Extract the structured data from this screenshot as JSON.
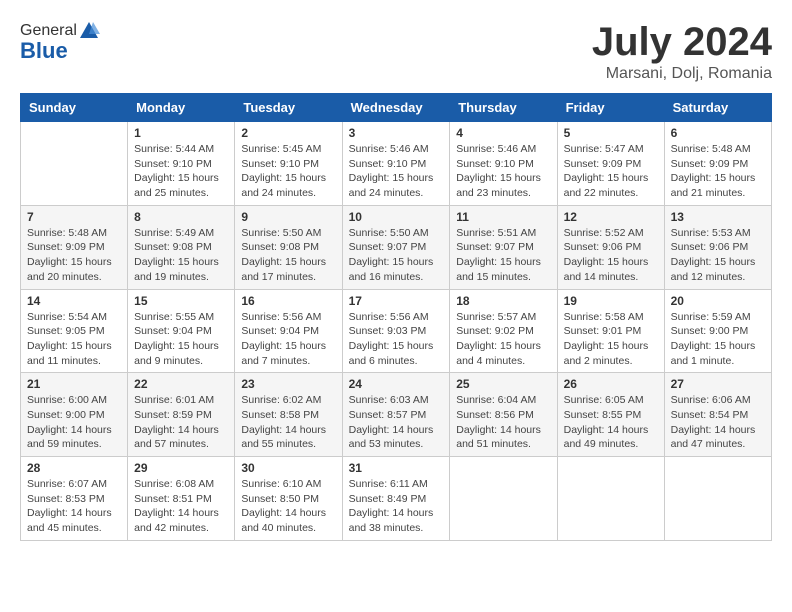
{
  "logo": {
    "general": "General",
    "blue": "Blue"
  },
  "header": {
    "month": "July 2024",
    "location": "Marsani, Dolj, Romania"
  },
  "weekdays": [
    "Sunday",
    "Monday",
    "Tuesday",
    "Wednesday",
    "Thursday",
    "Friday",
    "Saturday"
  ],
  "weeks": [
    [
      {
        "day": "",
        "sunrise": "",
        "sunset": "",
        "daylight": ""
      },
      {
        "day": "1",
        "sunrise": "Sunrise: 5:44 AM",
        "sunset": "Sunset: 9:10 PM",
        "daylight": "Daylight: 15 hours and 25 minutes."
      },
      {
        "day": "2",
        "sunrise": "Sunrise: 5:45 AM",
        "sunset": "Sunset: 9:10 PM",
        "daylight": "Daylight: 15 hours and 24 minutes."
      },
      {
        "day": "3",
        "sunrise": "Sunrise: 5:46 AM",
        "sunset": "Sunset: 9:10 PM",
        "daylight": "Daylight: 15 hours and 24 minutes."
      },
      {
        "day": "4",
        "sunrise": "Sunrise: 5:46 AM",
        "sunset": "Sunset: 9:10 PM",
        "daylight": "Daylight: 15 hours and 23 minutes."
      },
      {
        "day": "5",
        "sunrise": "Sunrise: 5:47 AM",
        "sunset": "Sunset: 9:09 PM",
        "daylight": "Daylight: 15 hours and 22 minutes."
      },
      {
        "day": "6",
        "sunrise": "Sunrise: 5:48 AM",
        "sunset": "Sunset: 9:09 PM",
        "daylight": "Daylight: 15 hours and 21 minutes."
      }
    ],
    [
      {
        "day": "7",
        "sunrise": "Sunrise: 5:48 AM",
        "sunset": "Sunset: 9:09 PM",
        "daylight": "Daylight: 15 hours and 20 minutes."
      },
      {
        "day": "8",
        "sunrise": "Sunrise: 5:49 AM",
        "sunset": "Sunset: 9:08 PM",
        "daylight": "Daylight: 15 hours and 19 minutes."
      },
      {
        "day": "9",
        "sunrise": "Sunrise: 5:50 AM",
        "sunset": "Sunset: 9:08 PM",
        "daylight": "Daylight: 15 hours and 17 minutes."
      },
      {
        "day": "10",
        "sunrise": "Sunrise: 5:50 AM",
        "sunset": "Sunset: 9:07 PM",
        "daylight": "Daylight: 15 hours and 16 minutes."
      },
      {
        "day": "11",
        "sunrise": "Sunrise: 5:51 AM",
        "sunset": "Sunset: 9:07 PM",
        "daylight": "Daylight: 15 hours and 15 minutes."
      },
      {
        "day": "12",
        "sunrise": "Sunrise: 5:52 AM",
        "sunset": "Sunset: 9:06 PM",
        "daylight": "Daylight: 15 hours and 14 minutes."
      },
      {
        "day": "13",
        "sunrise": "Sunrise: 5:53 AM",
        "sunset": "Sunset: 9:06 PM",
        "daylight": "Daylight: 15 hours and 12 minutes."
      }
    ],
    [
      {
        "day": "14",
        "sunrise": "Sunrise: 5:54 AM",
        "sunset": "Sunset: 9:05 PM",
        "daylight": "Daylight: 15 hours and 11 minutes."
      },
      {
        "day": "15",
        "sunrise": "Sunrise: 5:55 AM",
        "sunset": "Sunset: 9:04 PM",
        "daylight": "Daylight: 15 hours and 9 minutes."
      },
      {
        "day": "16",
        "sunrise": "Sunrise: 5:56 AM",
        "sunset": "Sunset: 9:04 PM",
        "daylight": "Daylight: 15 hours and 7 minutes."
      },
      {
        "day": "17",
        "sunrise": "Sunrise: 5:56 AM",
        "sunset": "Sunset: 9:03 PM",
        "daylight": "Daylight: 15 hours and 6 minutes."
      },
      {
        "day": "18",
        "sunrise": "Sunrise: 5:57 AM",
        "sunset": "Sunset: 9:02 PM",
        "daylight": "Daylight: 15 hours and 4 minutes."
      },
      {
        "day": "19",
        "sunrise": "Sunrise: 5:58 AM",
        "sunset": "Sunset: 9:01 PM",
        "daylight": "Daylight: 15 hours and 2 minutes."
      },
      {
        "day": "20",
        "sunrise": "Sunrise: 5:59 AM",
        "sunset": "Sunset: 9:00 PM",
        "daylight": "Daylight: 15 hours and 1 minute."
      }
    ],
    [
      {
        "day": "21",
        "sunrise": "Sunrise: 6:00 AM",
        "sunset": "Sunset: 9:00 PM",
        "daylight": "Daylight: 14 hours and 59 minutes."
      },
      {
        "day": "22",
        "sunrise": "Sunrise: 6:01 AM",
        "sunset": "Sunset: 8:59 PM",
        "daylight": "Daylight: 14 hours and 57 minutes."
      },
      {
        "day": "23",
        "sunrise": "Sunrise: 6:02 AM",
        "sunset": "Sunset: 8:58 PM",
        "daylight": "Daylight: 14 hours and 55 minutes."
      },
      {
        "day": "24",
        "sunrise": "Sunrise: 6:03 AM",
        "sunset": "Sunset: 8:57 PM",
        "daylight": "Daylight: 14 hours and 53 minutes."
      },
      {
        "day": "25",
        "sunrise": "Sunrise: 6:04 AM",
        "sunset": "Sunset: 8:56 PM",
        "daylight": "Daylight: 14 hours and 51 minutes."
      },
      {
        "day": "26",
        "sunrise": "Sunrise: 6:05 AM",
        "sunset": "Sunset: 8:55 PM",
        "daylight": "Daylight: 14 hours and 49 minutes."
      },
      {
        "day": "27",
        "sunrise": "Sunrise: 6:06 AM",
        "sunset": "Sunset: 8:54 PM",
        "daylight": "Daylight: 14 hours and 47 minutes."
      }
    ],
    [
      {
        "day": "28",
        "sunrise": "Sunrise: 6:07 AM",
        "sunset": "Sunset: 8:53 PM",
        "daylight": "Daylight: 14 hours and 45 minutes."
      },
      {
        "day": "29",
        "sunrise": "Sunrise: 6:08 AM",
        "sunset": "Sunset: 8:51 PM",
        "daylight": "Daylight: 14 hours and 42 minutes."
      },
      {
        "day": "30",
        "sunrise": "Sunrise: 6:10 AM",
        "sunset": "Sunset: 8:50 PM",
        "daylight": "Daylight: 14 hours and 40 minutes."
      },
      {
        "day": "31",
        "sunrise": "Sunrise: 6:11 AM",
        "sunset": "Sunset: 8:49 PM",
        "daylight": "Daylight: 14 hours and 38 minutes."
      },
      {
        "day": "",
        "sunrise": "",
        "sunset": "",
        "daylight": ""
      },
      {
        "day": "",
        "sunrise": "",
        "sunset": "",
        "daylight": ""
      },
      {
        "day": "",
        "sunrise": "",
        "sunset": "",
        "daylight": ""
      }
    ]
  ]
}
